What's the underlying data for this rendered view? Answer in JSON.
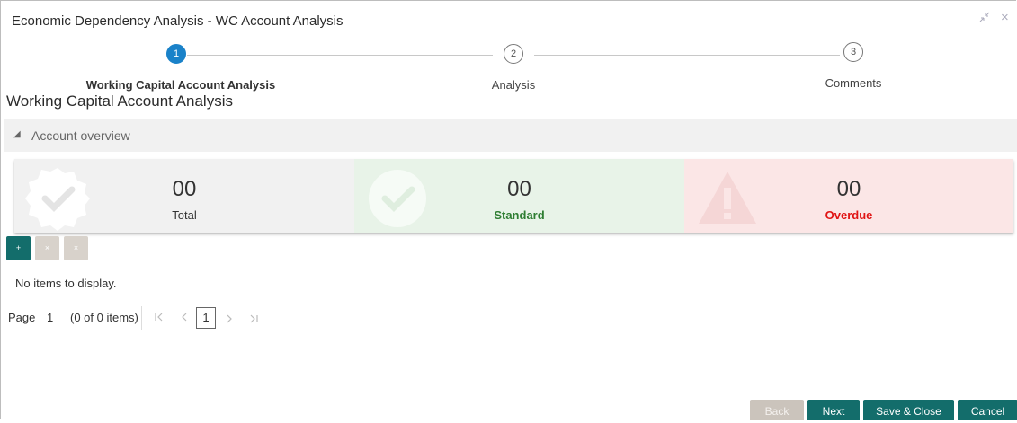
{
  "window": {
    "title": "Economic Dependency Analysis - WC Account Analysis",
    "minimize_glyph": "↗↙",
    "close_glyph": "×"
  },
  "steps": [
    {
      "number": "1",
      "label": "Working Capital Account Analysis",
      "state": "active"
    },
    {
      "number": "2",
      "label": "Analysis",
      "state": "idle"
    },
    {
      "number": "3",
      "label": "Comments",
      "state": "idle"
    }
  ],
  "section_title": "Working Capital Account Analysis",
  "accordion": {
    "arrow": "◢",
    "label": "Account overview"
  },
  "cards": [
    {
      "value": "00",
      "label": "Total",
      "label_color": "#333333",
      "bg": "#f1f1f1",
      "icon": "check-badge-icon"
    },
    {
      "value": "00",
      "label": "Standard",
      "label_color": "#2e7d32",
      "bg": "#e8f3e8",
      "icon": "check-circle-icon"
    },
    {
      "value": "00",
      "label": "Overdue",
      "label_color": "#e01414",
      "bg": "#fbe6e6",
      "icon": "warning-icon"
    }
  ],
  "toolbar": {
    "add": "+",
    "edit": "×",
    "delete": "×"
  },
  "table": {
    "empty_message": "No items to display."
  },
  "pager": {
    "page_label": "Page",
    "page_number": "1",
    "items_info": "(0 of 0 items)",
    "first": "|<",
    "prev": "<",
    "current": "1",
    "next": ">",
    "last": ">|"
  },
  "footer": {
    "back": "Back",
    "next": "Next",
    "save_close": "Save & Close",
    "cancel": "Cancel"
  },
  "colors": {
    "accent": "#1a82c9",
    "teal": "#136d6b",
    "muted_button": "#cbc4bc"
  }
}
